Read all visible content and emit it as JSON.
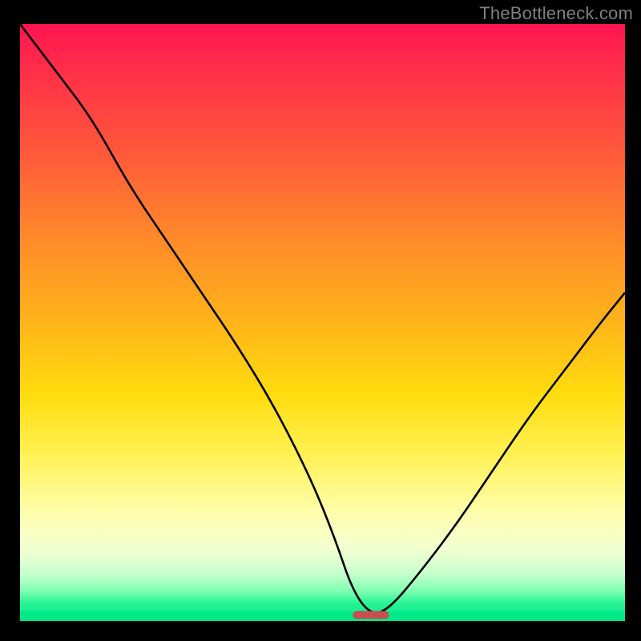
{
  "watermark": "TheBottleneck.com",
  "palette": {
    "gradient_stops": [
      "#ff1450",
      "#ff2f49",
      "#ff5a3a",
      "#ff8a2a",
      "#ffb41a",
      "#ffdc0e",
      "#fff153",
      "#fffeae",
      "#f2ffd2",
      "#c8ffcf",
      "#7effb0",
      "#28f396",
      "#01e987"
    ],
    "curve_color": "#000000",
    "marker_color": "#c54e4e",
    "background": "#000000"
  },
  "chart_data": {
    "type": "line",
    "title": "",
    "xlabel": "",
    "ylabel": "",
    "xlim": [
      0,
      100
    ],
    "ylim": [
      0,
      100
    ],
    "minimum_x": 58,
    "marker": {
      "x_range": [
        55,
        61
      ],
      "y": 1
    },
    "series": [
      {
        "name": "bottleneck-curve",
        "x": [
          0,
          6,
          12,
          18,
          24,
          30,
          36,
          42,
          48,
          52,
          55,
          58,
          61,
          66,
          72,
          78,
          84,
          90,
          96,
          100
        ],
        "values": [
          100,
          92,
          84,
          73,
          64,
          55,
          46,
          36,
          24,
          14,
          5,
          1,
          2,
          8,
          16,
          25,
          34,
          42,
          50,
          55
        ]
      }
    ]
  }
}
